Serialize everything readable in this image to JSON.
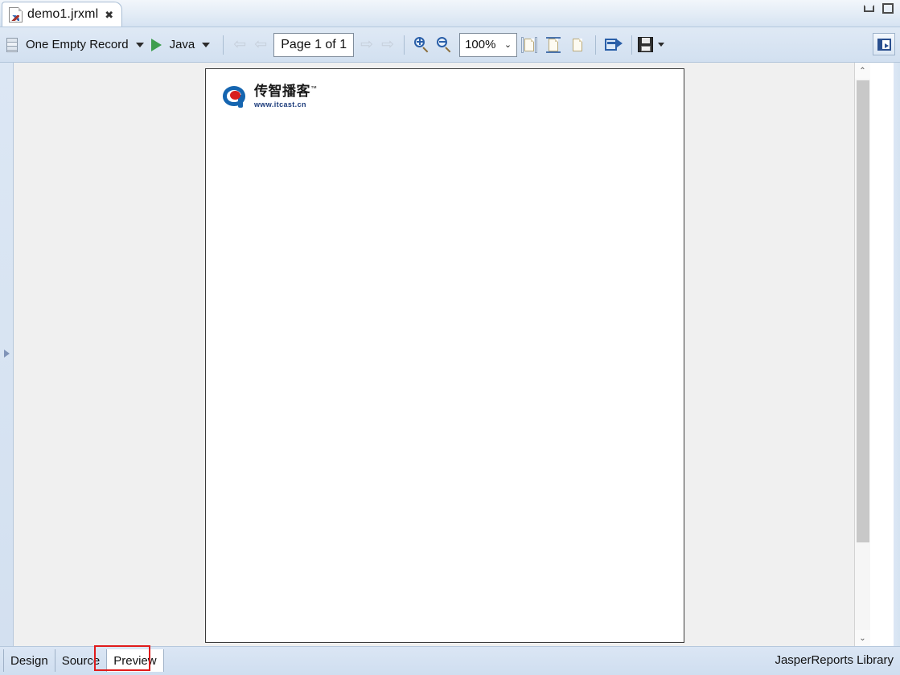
{
  "window": {
    "tab_title": "demo1.jrxml",
    "tab_close_glyph": "✖",
    "minimize_label": "Minimize",
    "maximize_label": "Maximize"
  },
  "toolbar": {
    "dataset_label": "One Empty Record",
    "dataset_icon": "database-icon",
    "dataset_dropdown_glyph": "▼",
    "run_icon": "play-icon",
    "language_label": "Java",
    "language_dropdown_glyph": "▼",
    "nav_first_glyph": "⇦",
    "nav_prev_glyph": "⇦",
    "page_indicator": "Page 1 of 1",
    "nav_next_glyph": "⇨",
    "nav_last_glyph": "⇨",
    "zoom_in_icon": "zoom-in-icon",
    "zoom_out_icon": "zoom-out-icon",
    "zoom_value": "100%",
    "zoom_chevron_glyph": "⌄",
    "fit_actual_icon": "actual-size-icon",
    "fit_page_icon": "fit-page-icon",
    "fit_width_icon": "fit-width-icon",
    "export_icon": "export-icon",
    "save_icon": "save-icon",
    "save_dropdown_glyph": "▼",
    "panel_toggle_icon": "restore-panel-icon"
  },
  "viewer": {
    "expand_arrow_glyph": "▶",
    "report": {
      "logo_name": "传智播客",
      "logo_tm": "™",
      "logo_url": "www.itcast.cn",
      "logo_mark": "itcast-logo-icon"
    },
    "scrollbar": {
      "up_glyph": "⌃",
      "down_glyph": "⌄"
    }
  },
  "bottom": {
    "tabs": [
      {
        "label": "Design",
        "active": false
      },
      {
        "label": "Source",
        "active": false
      },
      {
        "label": "Preview",
        "active": true
      }
    ],
    "status_right": "JasperReports Library",
    "annotation_color": "#e01b1b"
  }
}
